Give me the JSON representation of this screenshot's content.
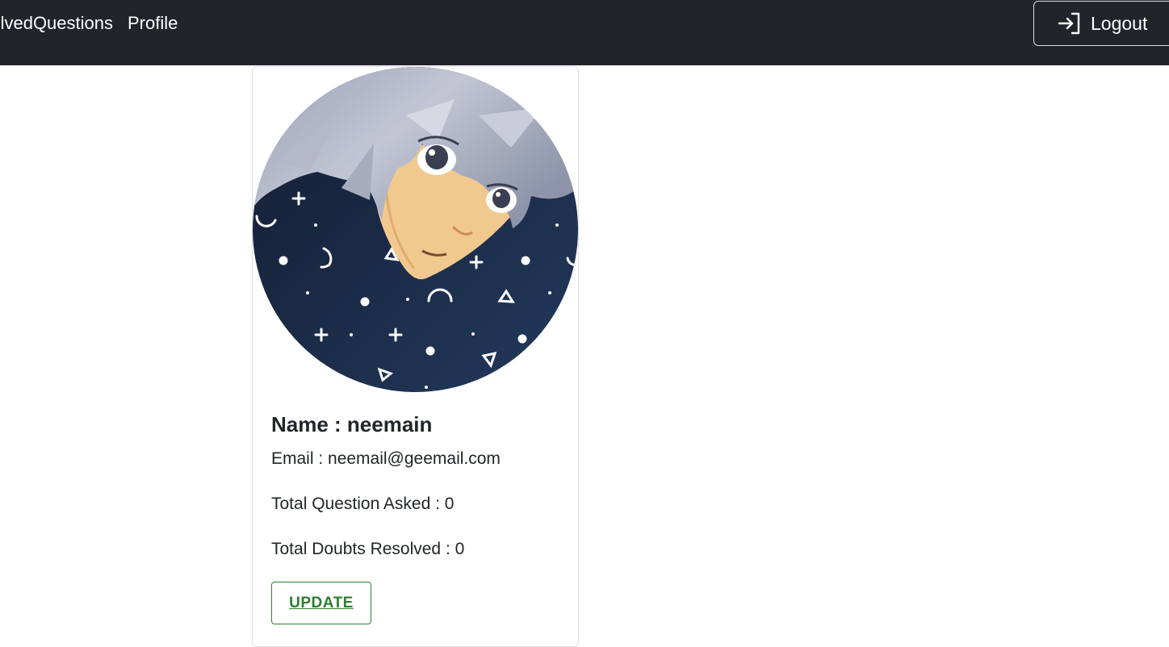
{
  "nav": {
    "solved_questions": "SolvedQuestions",
    "profile": "Profile",
    "logout": "Logout"
  },
  "profile": {
    "name": "Name : neemain",
    "email": "Email : neemail@geemail.com",
    "total_questions": "Total Question Asked : 0",
    "total_doubts": "Total Doubts Resolved : 0",
    "update_label": "UPDATE"
  },
  "colors": {
    "navbar": "#212529",
    "update_accent": "#2e7d32"
  },
  "icons": {
    "logout": "login-arrow-icon"
  }
}
